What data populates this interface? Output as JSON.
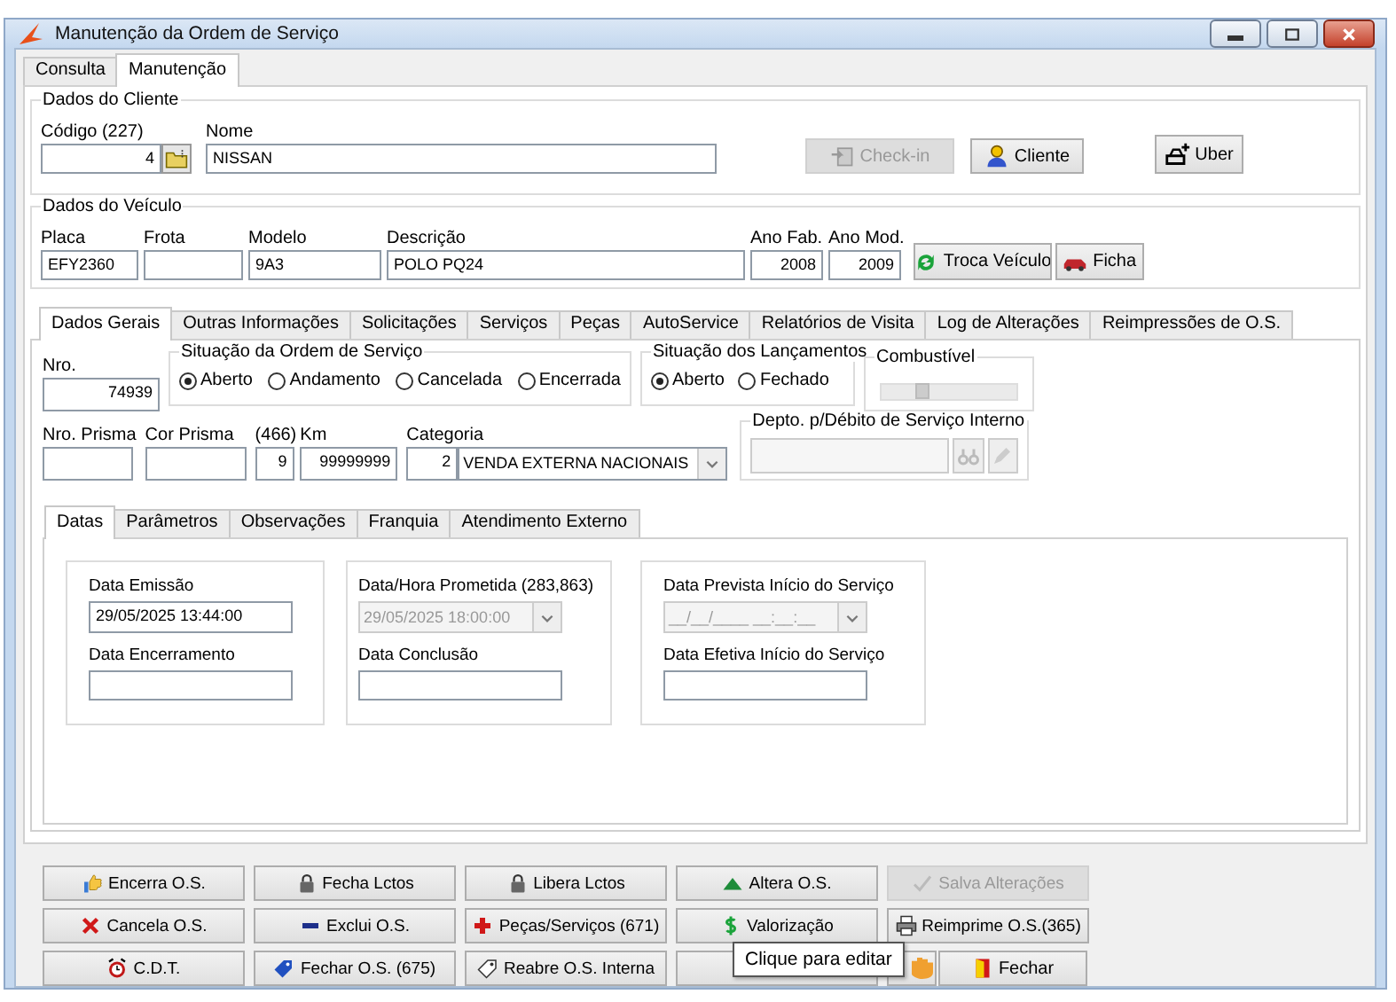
{
  "window": {
    "title": "Manutenção da Ordem de Serviço"
  },
  "top_tabs": [
    {
      "label": "Consulta",
      "selected": false
    },
    {
      "label": "Manutenção",
      "selected": true
    }
  ],
  "client": {
    "legend": "Dados do Cliente",
    "code_label": "Código (227)",
    "code": "4",
    "name_label": "Nome",
    "name": "NISSAN",
    "buttons": [
      {
        "label": "Check-in",
        "disabled": true
      },
      {
        "label": "Cliente",
        "disabled": false
      },
      {
        "label": "Uber",
        "disabled": false
      }
    ]
  },
  "vehicle": {
    "legend": "Dados do Veículo",
    "fields": [
      {
        "label": "Placa",
        "value": "EFY2360",
        "kind": "text"
      },
      {
        "label": "Frota",
        "kind": "text"
      },
      {
        "label": "Modelo",
        "value": "9A3",
        "kind": "text"
      },
      {
        "label": "Descrição",
        "value": "POLO PQ24",
        "kind": "text"
      },
      {
        "label": "Ano Fab.",
        "value": "2008",
        "kind": "number"
      },
      {
        "label": "Ano Mod.",
        "value": "2009",
        "kind": "number"
      }
    ],
    "buttons": [
      {
        "label": "Troca Veículo",
        "disabled": false
      },
      {
        "label": "Ficha",
        "disabled": false
      }
    ]
  },
  "main_tabs": [
    {
      "label": "Dados Gerais",
      "selected": true
    },
    {
      "label": "Outras Informações",
      "selected": false
    },
    {
      "label": "Solicitações",
      "selected": false
    },
    {
      "label": "Serviços",
      "selected": false
    },
    {
      "label": "Peças",
      "selected": false
    },
    {
      "label": "AutoService",
      "selected": false
    },
    {
      "label": "Relatórios de Visita",
      "selected": false
    },
    {
      "label": "Log de Alterações",
      "selected": false
    },
    {
      "label": "Reimpressões de O.S.",
      "selected": false
    }
  ],
  "general": {
    "nro_label": "Nro.",
    "nro": "74939",
    "status_group": {
      "legend": "Situação da Ordem de Serviço",
      "options": [
        {
          "label": "Aberto",
          "selected": true
        },
        {
          "label": "Andamento",
          "selected": false
        },
        {
          "label": "Cancelada",
          "selected": false
        },
        {
          "label": "Encerrada",
          "selected": false
        }
      ]
    },
    "launch_group": {
      "legend": "Situação dos Lançamentos",
      "options": [
        {
          "label": "Aberto",
          "selected": true
        },
        {
          "label": "Fechado",
          "selected": false
        }
      ]
    },
    "fuel": {
      "legend": "Combustível",
      "level": 0.3
    },
    "fields": [
      {
        "label": "Nro. Prisma",
        "kind": "text"
      },
      {
        "label": "Cor Prisma",
        "kind": "text"
      },
      {
        "label": "(466)",
        "value": "9",
        "kind": "number"
      },
      {
        "label": "Km",
        "value": "99999999",
        "kind": "number"
      }
    ],
    "category": {
      "label": "Categoria",
      "code": "2",
      "value": "VENDA EXTERNA NACIONAIS"
    },
    "dept": {
      "legend": "Depto. p/Débito de Serviço Interno"
    }
  },
  "sub_tabs": [
    {
      "label": "Datas",
      "selected": true
    },
    {
      "label": "Parâmetros",
      "selected": false
    },
    {
      "label": "Observações",
      "selected": false
    },
    {
      "label": "Franquia",
      "selected": false
    },
    {
      "label": "Atendimento Externo",
      "selected": false
    }
  ],
  "date_groups": [
    {
      "fields": [
        {
          "label": "Data Emissão",
          "value": "29/05/2025 13:44:00",
          "kind": "text",
          "disabled": false
        },
        {
          "label": "Data Encerramento",
          "kind": "text",
          "disabled": false
        }
      ]
    },
    {
      "fields": [
        {
          "label": "Data/Hora Prometida (283,863)",
          "value": "29/05/2025 18:00:00",
          "kind": "combo",
          "disabled": true
        },
        {
          "label": "Data Conclusão",
          "kind": "text",
          "disabled": false
        }
      ]
    },
    {
      "fields": [
        {
          "label": "Data Prevista Início do Serviço",
          "value": "__/__/____ __:__:__",
          "kind": "combo",
          "disabled": true
        },
        {
          "label": "Data Efetiva Início do Serviço",
          "kind": "text",
          "disabled": false
        }
      ]
    }
  ],
  "actions": [
    [
      {
        "label": "Encerra O.S.",
        "disabled": false,
        "kind": "wide"
      },
      {
        "label": "Fecha Lctos",
        "disabled": false,
        "kind": "wide"
      },
      {
        "label": "Libera Lctos",
        "disabled": false,
        "kind": "wide"
      },
      {
        "label": "Altera O.S.",
        "disabled": false,
        "kind": "wide"
      },
      {
        "label": "Salva Alterações",
        "disabled": true,
        "kind": "wide"
      }
    ],
    [
      {
        "label": "Cancela O.S.",
        "disabled": false,
        "kind": "wide"
      },
      {
        "label": "Exclui O.S.",
        "disabled": false,
        "kind": "wide"
      },
      {
        "label": "Peças/Serviços (671)",
        "disabled": false,
        "kind": "wide"
      },
      {
        "label": "Valorização",
        "disabled": false,
        "kind": "wide"
      },
      {
        "label": "Reimprime O.S.(365)",
        "disabled": false,
        "kind": "wide"
      }
    ],
    [
      {
        "label": "C.D.T.",
        "disabled": false,
        "kind": "wide"
      },
      {
        "label": "Fechar O.S. (675)",
        "disabled": false,
        "kind": "wide"
      },
      {
        "label": "Reabre O.S. Interna",
        "disabled": false,
        "kind": "wide"
      },
      {
        "disabled": false,
        "kind": "wide"
      },
      {
        "disabled": false,
        "kind": "small"
      },
      {
        "label": "Fechar",
        "disabled": false,
        "kind": "medium"
      }
    ]
  ],
  "tooltip": "Clique para editar"
}
